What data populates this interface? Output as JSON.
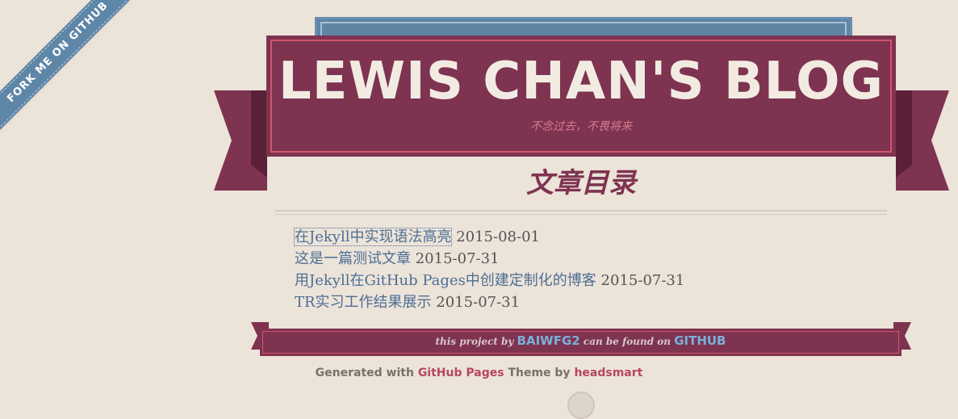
{
  "fork_ribbon": {
    "label": "FORK ME ON GITHUB"
  },
  "header": {
    "title": "LEWIS CHAN'S BLOG",
    "subtitle": "不念过去，不畏将来"
  },
  "page": {
    "heading": "文章目录"
  },
  "posts": [
    {
      "title": "在Jekyll中实现语法高亮",
      "date": "2015-08-01"
    },
    {
      "title": "这是一篇测试文章",
      "date": "2015-07-31"
    },
    {
      "title": "用Jekyll在GitHub Pages中创建定制化的博客",
      "date": "2015-07-31"
    },
    {
      "title": "TR实习工作结果展示",
      "date": "2015-07-31"
    }
  ],
  "footer": {
    "project_text_1": "this project by",
    "author": "BAIWFG2",
    "project_text_2": "can be found on",
    "host": "GITHUB",
    "generated_prefix": "Generated with",
    "generated_link": "GitHub Pages",
    "theme_prefix": "Theme by",
    "theme_link": "headsmart"
  },
  "colors": {
    "background": "#ece3d9",
    "banner": "#7e3350",
    "accent_blue": "#5e86a7",
    "link": "#4d6f95"
  }
}
